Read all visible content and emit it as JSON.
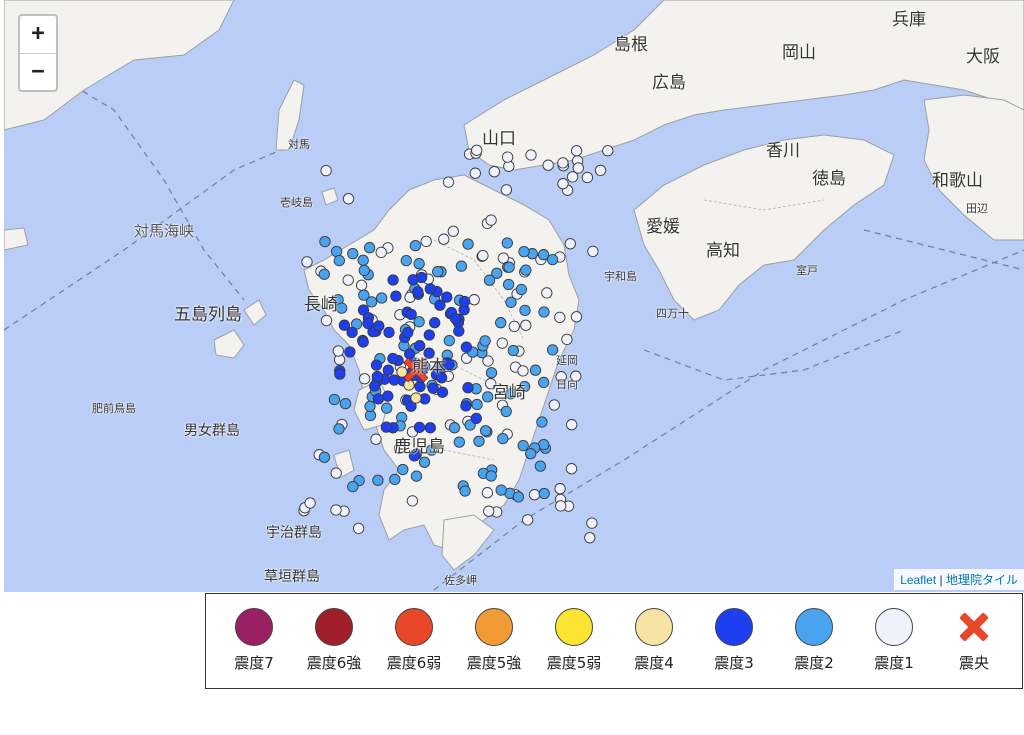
{
  "map": {
    "zoom_in": "+",
    "zoom_out": "−",
    "attribution": {
      "leaflet": "Leaflet",
      "separator": " | ",
      "tiles": "地理院タイル"
    },
    "labels": [
      {
        "text": "島根",
        "cls": "big"
      },
      {
        "text": "広島",
        "cls": "big"
      },
      {
        "text": "岡山",
        "cls": "big"
      },
      {
        "text": "兵庫",
        "cls": "big"
      },
      {
        "text": "大阪",
        "cls": "big"
      },
      {
        "text": "山口",
        "cls": "big"
      },
      {
        "text": "香川",
        "cls": "big"
      },
      {
        "text": "徳島",
        "cls": "big"
      },
      {
        "text": "愛媛",
        "cls": "big"
      },
      {
        "text": "高知",
        "cls": "big"
      },
      {
        "text": "和歌山",
        "cls": "big"
      },
      {
        "text": "宮崎",
        "cls": "big"
      },
      {
        "text": "長崎",
        "cls": "big"
      },
      {
        "text": "熊本",
        "cls": "big"
      },
      {
        "text": "鹿児島",
        "cls": "big"
      },
      {
        "text": "五島列島",
        "cls": "big"
      },
      {
        "text": "男女群島",
        "cls": ""
      },
      {
        "text": "宇治群島",
        "cls": ""
      },
      {
        "text": "草垣群島",
        "cls": ""
      },
      {
        "text": "対馬海峡",
        "cls": "sea"
      },
      {
        "text": "対馬",
        "cls": "small"
      },
      {
        "text": "壱岐島",
        "cls": "small"
      },
      {
        "text": "肥前鳥島",
        "cls": "small"
      },
      {
        "text": "延岡",
        "cls": "small"
      },
      {
        "text": "日向",
        "cls": "small"
      },
      {
        "text": "宇和島",
        "cls": "small"
      },
      {
        "text": "四万十",
        "cls": "small"
      },
      {
        "text": "室戸",
        "cls": "small"
      },
      {
        "text": "田辺",
        "cls": "small"
      },
      {
        "text": "佐多岬",
        "cls": "small"
      }
    ],
    "epicenter_label": "震央"
  },
  "legend": [
    {
      "label": "震度7",
      "color": "#9b2063",
      "kind": "circle"
    },
    {
      "label": "震度6強",
      "color": "#a01f2a",
      "kind": "circle"
    },
    {
      "label": "震度6弱",
      "color": "#e8472a",
      "kind": "circle"
    },
    {
      "label": "震度5強",
      "color": "#f29a35",
      "kind": "circle"
    },
    {
      "label": "震度5弱",
      "color": "#fbe432",
      "kind": "circle"
    },
    {
      "label": "震度4",
      "color": "#f6e4a4",
      "kind": "circle"
    },
    {
      "label": "震度3",
      "color": "#1e3ff0",
      "kind": "circle"
    },
    {
      "label": "震度2",
      "color": "#4aa3ef",
      "kind": "circle"
    },
    {
      "label": "震度1",
      "color": "#f0f2fb",
      "kind": "circle"
    },
    {
      "label": "震央",
      "color": "#e8472a",
      "kind": "x"
    }
  ],
  "intensity_counts_shown": {
    "震度4": 3,
    "震度3": "many",
    "震度2": "many",
    "震度1": "many"
  }
}
